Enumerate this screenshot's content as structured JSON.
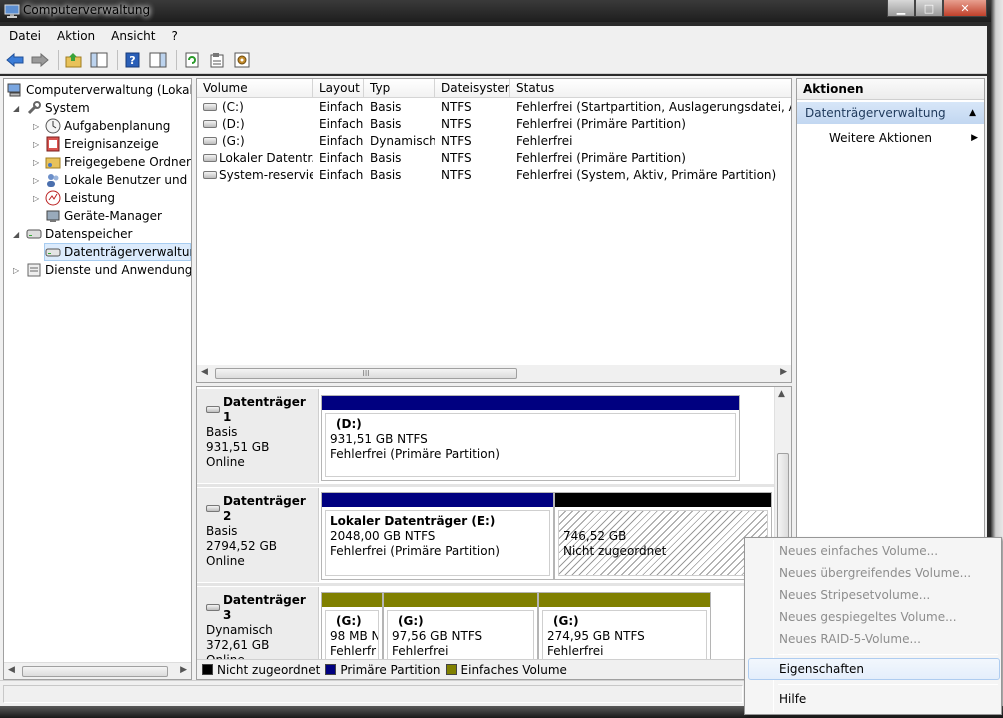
{
  "window": {
    "title": "Computerverwaltung"
  },
  "menu": [
    "Datei",
    "Aktion",
    "Ansicht",
    "?"
  ],
  "tree": {
    "root": "Computerverwaltung (Lokal)",
    "system": "System",
    "aufgabenplanung": "Aufgabenplanung",
    "ereignisanzeige": "Ereignisanzeige",
    "freigegebene_ordner": "Freigegebene Ordner",
    "lokale_benutzer": "Lokale Benutzer und Gru",
    "leistung": "Leistung",
    "geraete_manager": "Geräte-Manager",
    "datenspeicher": "Datenspeicher",
    "datentraegerverwaltung": "Datenträgerverwaltung",
    "dienste": "Dienste und Anwendungen"
  },
  "volume_list": {
    "columns": [
      "Volume",
      "Layout",
      "Typ",
      "Dateisystem",
      "Status"
    ],
    "rows": [
      {
        "volume": "(C:)",
        "layout": "Einfach",
        "typ": "Basis",
        "dateisystem": "NTFS",
        "status": "Fehlerfrei (Startpartition, Auslagerungsdatei, Absturz"
      },
      {
        "volume": "(D:)",
        "layout": "Einfach",
        "typ": "Basis",
        "dateisystem": "NTFS",
        "status": "Fehlerfrei (Primäre Partition)"
      },
      {
        "volume": "(G:)",
        "layout": "Einfach",
        "typ": "Dynamisch",
        "dateisystem": "NTFS",
        "status": "Fehlerfrei"
      },
      {
        "volume": "Lokaler Datentr...",
        "layout": "Einfach",
        "typ": "Basis",
        "dateisystem": "NTFS",
        "status": "Fehlerfrei (Primäre Partition)"
      },
      {
        "volume": "System-reserviert",
        "layout": "Einfach",
        "typ": "Basis",
        "dateisystem": "NTFS",
        "status": "Fehlerfrei (System, Aktiv, Primäre Partition)"
      }
    ],
    "scroll_grip": "III"
  },
  "disks": [
    {
      "name": "Datenträger 1",
      "type": "Basis",
      "size": "931,51 GB",
      "state": "Online",
      "partitions": [
        {
          "name": "(D:)",
          "size": "931,51 GB NTFS",
          "status": "Fehlerfrei (Primäre Partition)",
          "kind": "primary"
        }
      ]
    },
    {
      "name": "Datenträger 2",
      "type": "Basis",
      "size": "2794,52 GB",
      "state": "Online",
      "partitions": [
        {
          "name": "Lokaler Datenträger  (E:)",
          "size": "2048,00 GB NTFS",
          "status": "Fehlerfrei (Primäre Partition)",
          "kind": "primary"
        },
        {
          "name": "",
          "size": "746,52 GB",
          "status": "Nicht zugeordnet",
          "kind": "unallocated"
        }
      ]
    },
    {
      "name": "Datenträger 3",
      "type": "Dynamisch",
      "size": "372,61 GB",
      "state": "Online",
      "partitions": [
        {
          "name": "(G:)",
          "size": "98 MB N",
          "status": "Fehlerfr",
          "kind": "simple"
        },
        {
          "name": "(G:)",
          "size": "97,56 GB NTFS",
          "status": "Fehlerfrei",
          "kind": "simple"
        },
        {
          "name": "(G:)",
          "size": "274,95 GB NTFS",
          "status": "Fehlerfrei",
          "kind": "simple"
        }
      ]
    }
  ],
  "legend": [
    {
      "label": "Nicht zugeordnet",
      "color": "#000000"
    },
    {
      "label": "Primäre Partition",
      "color": "#000080"
    },
    {
      "label": "Einfaches Volume",
      "color": "#808000"
    }
  ],
  "actions": {
    "header": "Aktionen",
    "section": "Datenträgerverwaltung",
    "more": "Weitere Aktionen"
  },
  "context_menu": {
    "items": [
      {
        "label": "Neues einfaches Volume...",
        "disabled": true
      },
      {
        "label": "Neues übergreifendes Volume...",
        "disabled": true
      },
      {
        "label": "Neues Stripesetvolume...",
        "disabled": true
      },
      {
        "label": "Neues gespiegeltes Volume...",
        "disabled": true
      },
      {
        "label": "Neues RAID-5-Volume...",
        "disabled": true
      },
      {
        "label": "Eigenschaften",
        "disabled": false,
        "hover": true
      },
      {
        "label": "Hilfe",
        "disabled": false
      }
    ]
  },
  "colors": {
    "primary": "#000080",
    "simple": "#808000",
    "unallocated": "#000000",
    "selection": "#dcebfc"
  }
}
